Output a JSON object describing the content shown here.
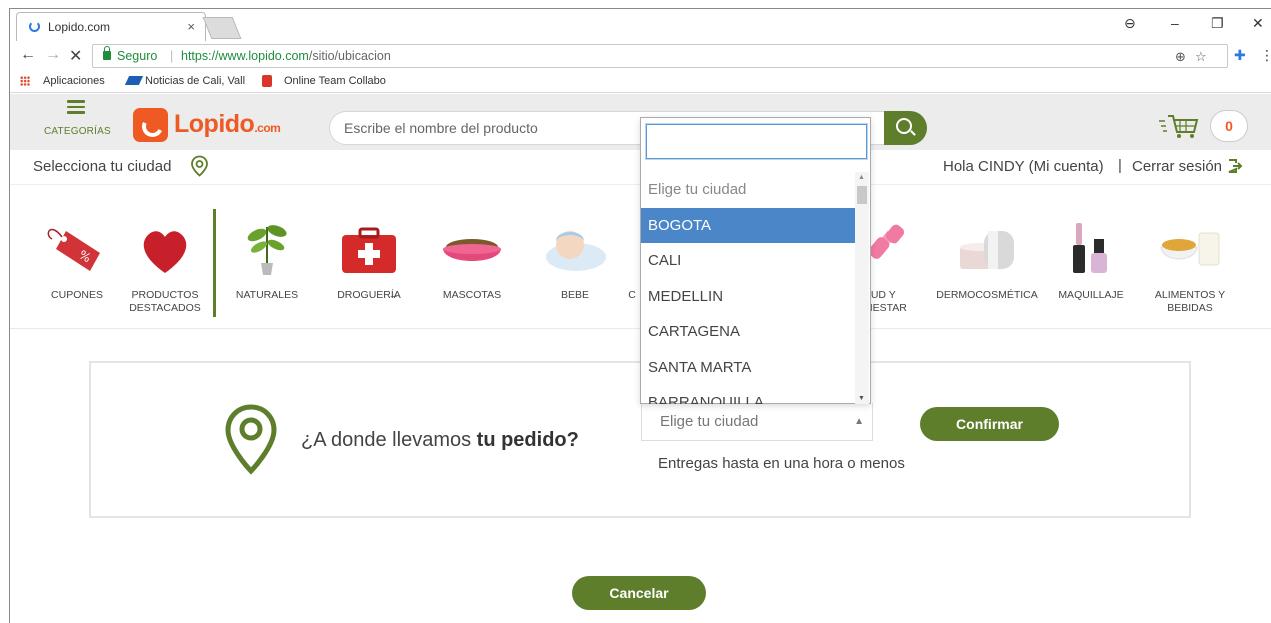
{
  "browser": {
    "tab_title": "Lopido.com",
    "tab_close": "×",
    "secure_label": "Seguro",
    "url_sep": "|",
    "url_host": "https://www.lopido.com",
    "url_path": "/sitio/ubicacion",
    "controls": {
      "minimize": "–",
      "maximize": "❐",
      "close": "✕",
      "profile": "⊖"
    },
    "nav": {
      "back": "←",
      "forward": "→",
      "stop": "✕"
    },
    "omni_icons": {
      "zoom": "⊕",
      "star": "☆",
      "ext": "✚",
      "menu": "⋮"
    },
    "bookmarks": [
      "Aplicaciones",
      "Noticias de Cali, Vall",
      "Online Team Collabo"
    ]
  },
  "header": {
    "categories_label": "CATEGORÍAS",
    "logo_text": "Lopido",
    "logo_suffix": ".com",
    "search_placeholder": "Escribe el nombre del producto",
    "cart_count": "0"
  },
  "user_bar": {
    "select_city": "Selecciona tu ciudad",
    "greeting": "Hola CINDY (Mi cuenta)",
    "separator": "|",
    "logout": "Cerrar sesión"
  },
  "categories": [
    {
      "label": "CUPONES",
      "icon": "coupon-tag-icon"
    },
    {
      "label": "PRODUCTOS DESTACADOS",
      "icon": "heart-icon"
    },
    {
      "label": "NATURALES",
      "icon": "plant-icon"
    },
    {
      "label": "DROGUERÍ̶A",
      "icon": "first-aid-kit-icon"
    },
    {
      "label": "MASCOTAS",
      "icon": "pet-bowl-icon"
    },
    {
      "label": "BEBE",
      "icon": "baby-icon"
    },
    {
      "label": "C",
      "icon": "category-icon"
    },
    {
      "label": "ALUD Y ENESTAR",
      "icon": "dumbbell-icon"
    },
    {
      "label": "DERMOCOSMÉTICA",
      "icon": "cream-jar-icon"
    },
    {
      "label": "MAQUILLAJE",
      "icon": "nail-polish-icon"
    },
    {
      "label": "ALIMENTOS Y BEBIDAS",
      "icon": "food-icon"
    }
  ],
  "location": {
    "question_prefix": "¿A donde llevamos ",
    "question_bold": "tu pedido?",
    "select_value": "Elige tu ciudad",
    "delivery_note": "Entregas hasta en una hora o menos",
    "confirm_label": "Confirmar",
    "cancel_label": "Cancelar"
  },
  "dropdown": {
    "search_value": "",
    "options": [
      "Elige tu ciudad",
      "BOGOTA",
      "CALI",
      "MEDELLIN",
      "CARTAGENA",
      "SANTA MARTA",
      "BARRANQUILLA"
    ],
    "selected": "BOGOTA"
  },
  "colors": {
    "brand_green": "#5e7e2c",
    "brand_orange": "#ef5a24",
    "selected_blue": "#4a86c8"
  }
}
